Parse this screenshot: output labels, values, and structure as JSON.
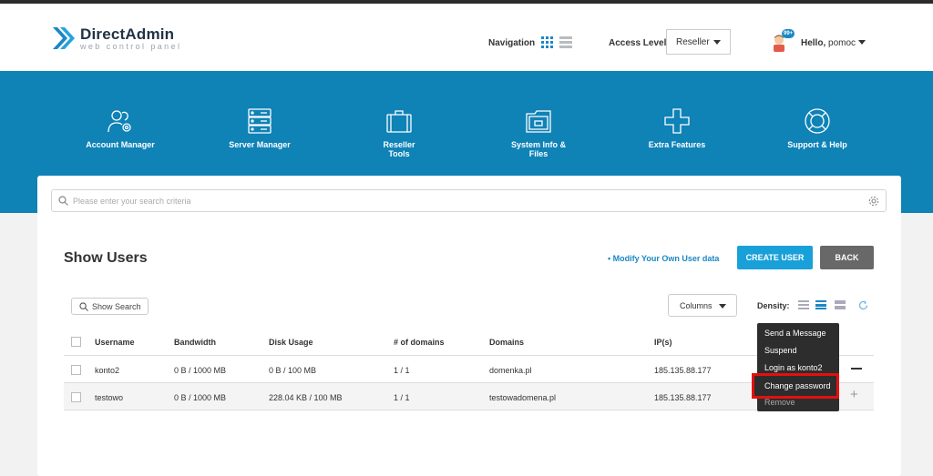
{
  "header": {
    "logo_title": "DirectAdmin",
    "logo_subtitle": "web control panel",
    "navigation_label": "Navigation",
    "access_level_label": "Access Level",
    "access_level_value": "Reseller",
    "notification_badge": "99+",
    "hello_label": "Hello,",
    "username": "pomoc"
  },
  "menu": [
    {
      "label": "Account Manager",
      "icon": "users-gear-icon"
    },
    {
      "label": "Server Manager",
      "icon": "server-icon"
    },
    {
      "label": "Reseller Tools",
      "icon": "briefcase-icon"
    },
    {
      "label": "System Info & Files",
      "icon": "folder-icon"
    },
    {
      "label": "Extra Features",
      "icon": "plus-icon"
    },
    {
      "label": "Support & Help",
      "icon": "lifebuoy-icon"
    }
  ],
  "search": {
    "placeholder": "Please enter your search criteria"
  },
  "page": {
    "title": "Show Users",
    "modify_link": "• Modify Your Own User data",
    "create_button": "CREATE USER",
    "back_button": "BACK"
  },
  "toolbar": {
    "show_search": "Show Search",
    "columns": "Columns",
    "density_label": "Density:"
  },
  "table": {
    "headers": [
      "Username",
      "Bandwidth",
      "Disk Usage",
      "# of domains",
      "Domains",
      "IP(s)"
    ],
    "rows": [
      {
        "username": "konto2",
        "bandwidth": "0 B / 1000 MB",
        "disk": "0 B / 100 MB",
        "domains_count": "1 / 1",
        "domains": "domenka.pl",
        "ip": "185.135.88.177"
      },
      {
        "username": "testowo",
        "bandwidth": "0 B / 1000 MB",
        "disk": "228.04 KB / 100 MB",
        "domains_count": "1 / 1",
        "domains": "testowadomena.pl",
        "ip": "185.135.88.177"
      }
    ]
  },
  "row_menu": {
    "items": [
      "Send a Message",
      "Suspend",
      "Login as konto2",
      "Change password",
      "Remove"
    ]
  },
  "colors": {
    "brand_blue": "#0f82b6",
    "button_blue": "#1aa0d8",
    "highlight_red": "#e41010"
  }
}
